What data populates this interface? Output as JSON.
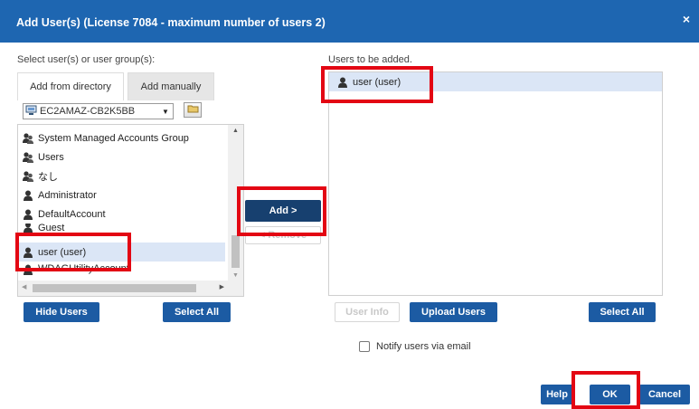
{
  "dialog": {
    "title": "Add User(s) (License 7084 - maximum number of users 2)",
    "close": "×"
  },
  "left": {
    "select_label": "Select user(s) or user group(s):",
    "tabs": [
      {
        "label": "Add from directory",
        "active": true
      },
      {
        "label": "Add manually",
        "active": false
      }
    ],
    "directory": {
      "value": "EC2AMAZ-CB2K5BB"
    },
    "items": [
      {
        "label": "System Managed Accounts Group",
        "icon": "group-icon"
      },
      {
        "label": "Users",
        "icon": "group-icon"
      },
      {
        "label": "なし",
        "icon": "group-icon"
      },
      {
        "label": "Administrator",
        "icon": "user-icon"
      },
      {
        "label": "DefaultAccount",
        "icon": "user-icon"
      },
      {
        "label": "Guest",
        "icon": "user-icon"
      },
      {
        "label": "user (user)",
        "icon": "user-icon",
        "selected": true
      },
      {
        "label": "WDAGUtilityAccount",
        "icon": "user-icon"
      }
    ],
    "hide_users": "Hide Users",
    "select_all": "Select All"
  },
  "middle": {
    "add": "Add >",
    "remove": "< Remove"
  },
  "right": {
    "label": "Users to be added.",
    "items": [
      {
        "label": "user (user)",
        "icon": "user-icon"
      }
    ],
    "user_info": "User Info",
    "upload_users": "Upload Users",
    "select_all": "Select All"
  },
  "notify": {
    "label": "Notify users via email",
    "checked": false
  },
  "footer": {
    "help": "Help",
    "ok": "OK",
    "cancel": "Cancel"
  },
  "colors": {
    "titlebar": "#1e66b1",
    "button": "#1c5ba3",
    "highlight": "#e30613",
    "selection": "#dbe6f6"
  }
}
